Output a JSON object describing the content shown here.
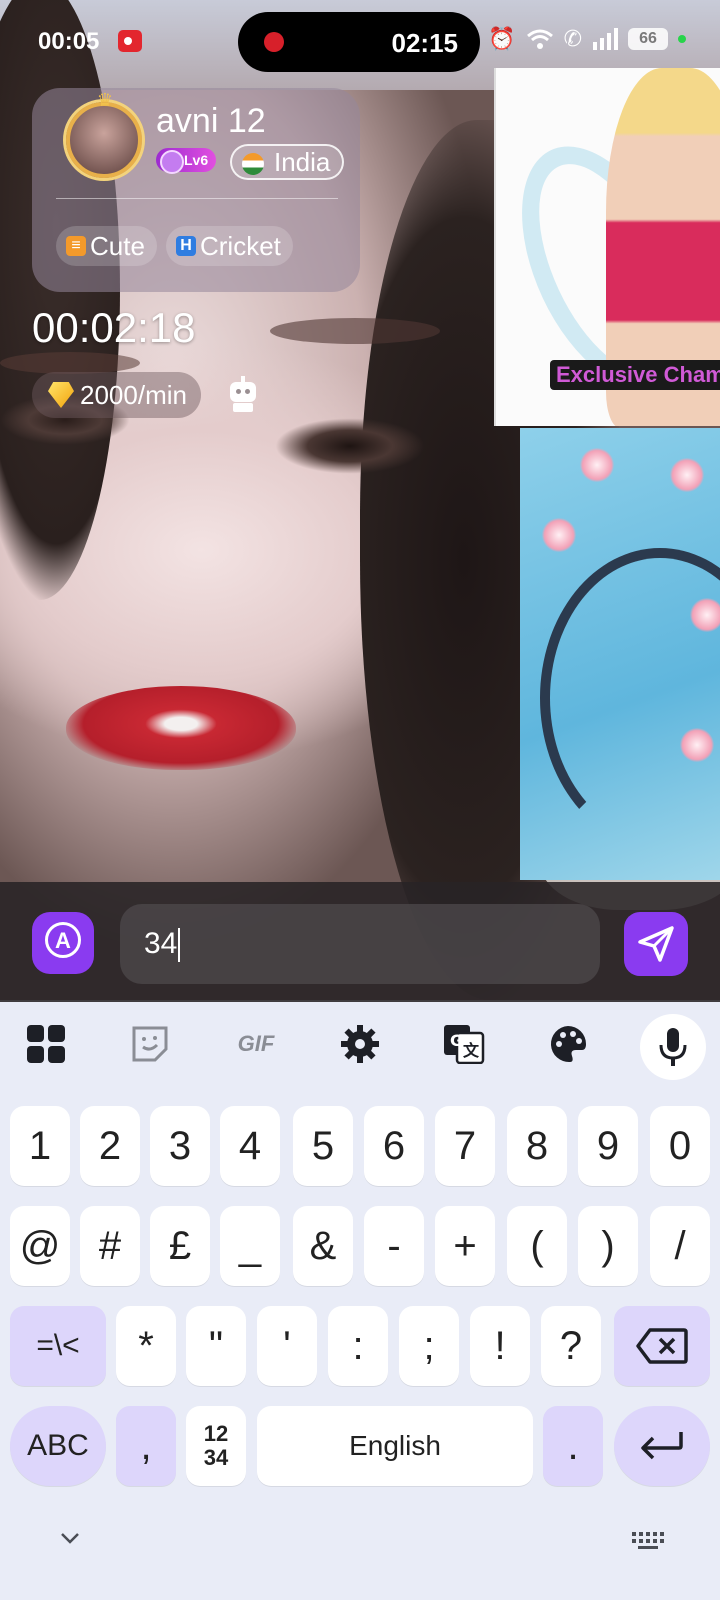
{
  "status_bar": {
    "time": "00:05",
    "pill_time": "02:15",
    "battery": "66"
  },
  "profile": {
    "name": "avni 12",
    "level": "Lv6",
    "country": "India",
    "tags": [
      "Cute",
      "Cricket"
    ]
  },
  "call": {
    "timer": "00:02:18",
    "rate": "2000/min"
  },
  "poster": {
    "tag": "Exclusive Cham"
  },
  "composer": {
    "value": "34"
  },
  "keyboard": {
    "toolbar": [
      "apps-icon",
      "sticker-icon",
      "GIF",
      "settings-icon",
      "translate-icon",
      "palette-icon",
      "mic-icon"
    ],
    "row1": [
      "1",
      "2",
      "3",
      "4",
      "5",
      "6",
      "7",
      "8",
      "9",
      "0"
    ],
    "row2": [
      "@",
      "#",
      "£",
      "_",
      "&",
      "-",
      "+",
      "(",
      ")",
      "/"
    ],
    "row3": [
      "=\\<",
      "*",
      "\"",
      "'",
      ":",
      ";",
      "!",
      "?"
    ],
    "row4": {
      "abc": "ABC",
      "comma": ",",
      "num_switch": "12\n34",
      "space": "English",
      "period": "."
    }
  },
  "colors": {
    "accent": "#8a3bf0",
    "key_fn": "#ddd6fb",
    "keyboard_bg": "#e9ecf7"
  }
}
